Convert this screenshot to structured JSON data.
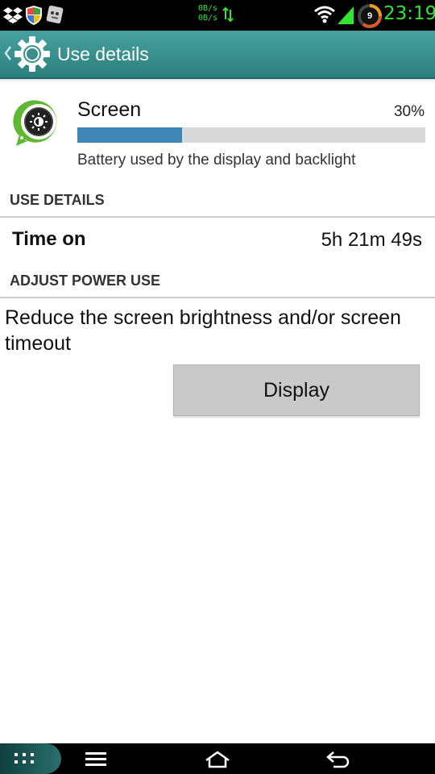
{
  "status_bar": {
    "net_up": "0B/s",
    "net_down": "0B/s",
    "battery_level": "9",
    "time": "23:19",
    "icons": [
      "dropbox-icon",
      "shield-icon",
      "robot-icon",
      "wifi-icon",
      "signal-icon",
      "data-arrows-icon",
      "battery-ring-icon"
    ],
    "accent_color": "#33e533"
  },
  "action_bar": {
    "title": "Use details",
    "icon": "gear-icon",
    "color": "#3a9290"
  },
  "app": {
    "name": "Screen",
    "percent_label": "30%",
    "usage_fraction": 0.3,
    "description": "Battery used by the display and backlight",
    "icon": "screen-brightness-icon"
  },
  "use_details": {
    "header": "USE DETAILS",
    "rows": [
      {
        "label": "Time on",
        "value": "5h 21m 49s"
      }
    ]
  },
  "adjust_power": {
    "header": "ADJUST POWER USE",
    "tip": "Reduce the screen brightness and/or screen timeout",
    "button_label": "Display"
  },
  "nav_bar": {
    "buttons": [
      "apps-grid-icon",
      "menu-icon",
      "home-icon",
      "back-icon"
    ]
  }
}
